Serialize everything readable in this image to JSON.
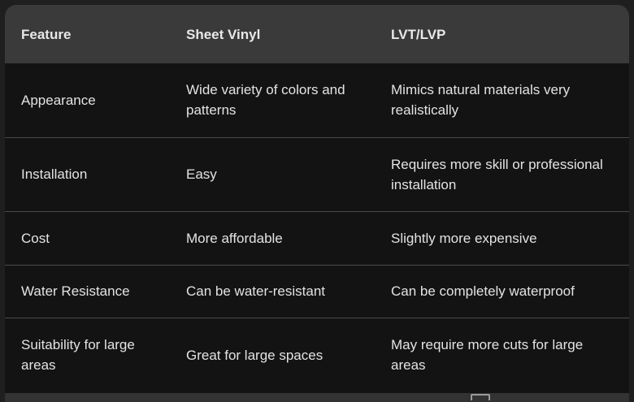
{
  "table": {
    "headers": [
      "Feature",
      "Sheet Vinyl",
      "LVT/LVP"
    ],
    "rows": [
      [
        "Appearance",
        "Wide variety of colors and patterns",
        "Mimics natural materials very realistically"
      ],
      [
        "Installation",
        "Easy",
        "Requires more skill or professional installation"
      ],
      [
        "Cost",
        "More affordable",
        "Slightly more expensive"
      ],
      [
        "Water Resistance",
        "Can be water-resistant",
        "Can be completely waterproof"
      ],
      [
        "Suitability for large areas",
        "Great for large spaces",
        "May require more cuts for large areas"
      ]
    ]
  },
  "icons": {
    "bottom_toolbar": "copy-icon"
  },
  "colors": {
    "header_bg": "#3a3a3a",
    "body_bg": "#131313",
    "divider": "#4a4a4a",
    "text": "#e3e3e3"
  }
}
